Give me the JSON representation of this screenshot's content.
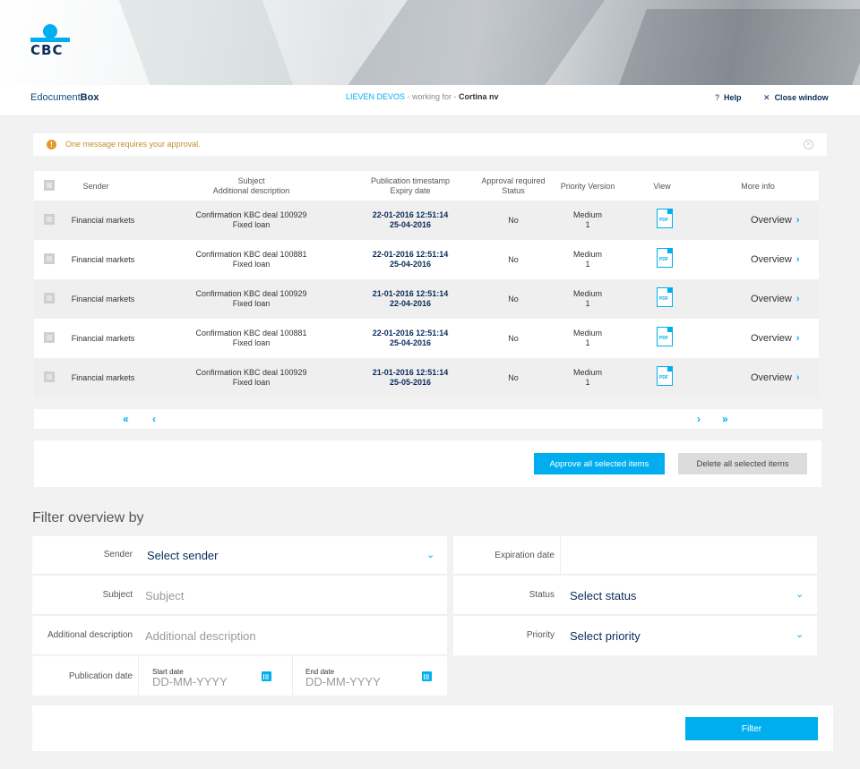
{
  "header": {
    "logo_text": "CBC",
    "brand_prefix": "Edocument",
    "brand_bold": "Box",
    "user_name": "LIEVEN DEVOS",
    "working_for": " - working for - ",
    "organization": "Cortina nv",
    "help": "Help",
    "close_window": "Close window"
  },
  "alert": {
    "message": "One message requires your approval."
  },
  "table": {
    "headers": {
      "sender": "Sender",
      "subject": "Subject",
      "additional_description": "Additional description",
      "publication_timestamp": "Publication timestamp",
      "expiry_date": "Expiry date",
      "approval_required": "Approval required",
      "status": "Status",
      "priority_version": "Priority Version",
      "view": "View",
      "more_info": "More info"
    },
    "rows": [
      {
        "sender": "Financial markets",
        "subject": "Confirmation KBC deal 100929",
        "description": "Fixed loan",
        "published": "22-01-2016 12:51:14",
        "expiry": "25-04-2016",
        "approval": "No",
        "priority": "Medium",
        "version": "1",
        "view": "PDF",
        "more": "Overview"
      },
      {
        "sender": "Financial markets",
        "subject": "Confirmation KBC deal 100881",
        "description": "Fixed loan",
        "published": "22-01-2016 12:51:14",
        "expiry": "25-04-2016",
        "approval": "No",
        "priority": "Medium",
        "version": "1",
        "view": "PDF",
        "more": "Overview"
      },
      {
        "sender": "Financial markets",
        "subject": "Confirmation KBC deal 100929",
        "description": "Fixed loan",
        "published": "21-01-2016 12:51:14",
        "expiry": "22-04-2016",
        "approval": "No",
        "priority": "Medium",
        "version": "1",
        "view": "PDF",
        "more": "Overview"
      },
      {
        "sender": "Financial markets",
        "subject": "Confirmation KBC deal 100881",
        "description": "Fixed loan",
        "published": "22-01-2016 12:51:14",
        "expiry": "25-04-2016",
        "approval": "No",
        "priority": "Medium",
        "version": "1",
        "view": "PDF",
        "more": "Overview"
      },
      {
        "sender": "Financial markets",
        "subject": "Confirmation KBC deal 100929",
        "description": "Fixed loan",
        "published": "21-01-2016 12:51:14",
        "expiry": "25-05-2016",
        "approval": "No",
        "priority": "Medium",
        "version": "1",
        "view": "PDF",
        "more": "Overview"
      }
    ]
  },
  "pager": {
    "first": "«",
    "prev": "‹",
    "next": "›",
    "last": "»"
  },
  "actions": {
    "approve": "Approve all selected items",
    "delete": "Delete all selected items"
  },
  "filter": {
    "title": "Filter overview by",
    "sender_label": "Sender",
    "sender_value": "Select sender",
    "subject_label": "Subject",
    "subject_placeholder": "Subject",
    "additional_label": "Additional description",
    "additional_placeholder": "Additional description",
    "publication_label": "Publication date",
    "start_label": "Start date",
    "start_placeholder": "DD-MM-YYYY",
    "end_label": "End date",
    "end_placeholder": "DD-MM-YYYY",
    "expiration_label": "Expiration date",
    "status_label": "Status",
    "status_value": "Select status",
    "priority_label": "Priority",
    "priority_value": "Select priority",
    "button": "Filter"
  },
  "colors": {
    "accent": "#00aeef",
    "navy": "#0a2c5a",
    "warning": "#e29a2b"
  }
}
